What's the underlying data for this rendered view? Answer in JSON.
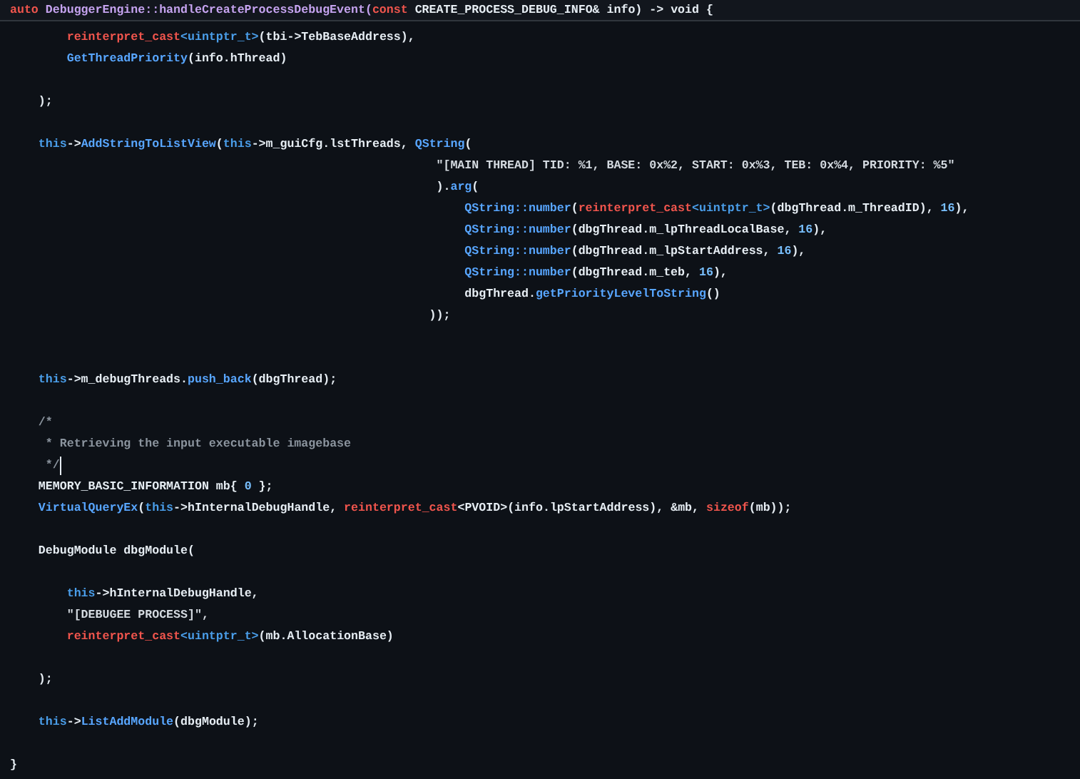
{
  "sticky_header": {
    "tokens": [
      {
        "kind": "cast",
        "text": "auto"
      },
      {
        "kind": "name",
        "text": " DebuggerEngine::handleCreateProcessDebugEvent("
      },
      {
        "kind": "cast",
        "text": "const"
      },
      {
        "kind": "plain",
        "text": " CREATE_PROCESS_DEBUG_INFO& info) -> void {"
      }
    ]
  },
  "lines": [
    {
      "cursor": false,
      "tokens": [
        {
          "kind": "cast",
          "text": "        reinterpret_cast"
        },
        {
          "kind": "keyword",
          "text": "<uintptr_t>"
        },
        {
          "kind": "plain",
          "text": "(tbi->TebBaseAddress),"
        }
      ]
    },
    {
      "cursor": false,
      "tokens": [
        {
          "kind": "function",
          "text": "        GetThreadPriority"
        },
        {
          "kind": "plain",
          "text": "(info.hThread)"
        }
      ]
    },
    {
      "cursor": false
    },
    {
      "cursor": false,
      "tokens": [
        {
          "kind": "plain",
          "text": "    );"
        }
      ]
    },
    {
      "cursor": false
    },
    {
      "cursor": false,
      "tokens": [
        {
          "kind": "keyword",
          "text": "    this"
        },
        {
          "kind": "plain",
          "text": "->"
        },
        {
          "kind": "function",
          "text": "AddStringToListView"
        },
        {
          "kind": "plain",
          "text": "("
        },
        {
          "kind": "keyword",
          "text": "this"
        },
        {
          "kind": "plain",
          "text": "->m_guiCfg.lstThreads, "
        },
        {
          "kind": "function",
          "text": "QString"
        },
        {
          "kind": "plain",
          "text": "("
        }
      ]
    },
    {
      "cursor": false,
      "tokens": [
        {
          "kind": "string",
          "text": "                                                            \"[MAIN THREAD] TID: %1, BASE: 0x%2, START: 0x%3, TEB: 0x%4, PRIORITY: %5\""
        }
      ]
    },
    {
      "cursor": false,
      "tokens": [
        {
          "kind": "plain",
          "text": "                                                            )."
        },
        {
          "kind": "function",
          "text": "arg"
        },
        {
          "kind": "plain",
          "text": "("
        }
      ]
    },
    {
      "cursor": false,
      "tokens": [
        {
          "kind": "function",
          "text": "                                                                QString::number"
        },
        {
          "kind": "plain",
          "text": "("
        },
        {
          "kind": "cast",
          "text": "reinterpret_cast"
        },
        {
          "kind": "keyword",
          "text": "<uintptr_t>"
        },
        {
          "kind": "plain",
          "text": "(dbgThread.m_ThreadID), "
        },
        {
          "kind": "number",
          "text": "16"
        },
        {
          "kind": "plain",
          "text": "),"
        }
      ]
    },
    {
      "cursor": false,
      "tokens": [
        {
          "kind": "function",
          "text": "                                                                QString::number"
        },
        {
          "kind": "plain",
          "text": "(dbgThread.m_lpThreadLocalBase, "
        },
        {
          "kind": "number",
          "text": "16"
        },
        {
          "kind": "plain",
          "text": "),"
        }
      ]
    },
    {
      "cursor": false,
      "tokens": [
        {
          "kind": "function",
          "text": "                                                                QString::number"
        },
        {
          "kind": "plain",
          "text": "(dbgThread.m_lpStartAddress, "
        },
        {
          "kind": "number",
          "text": "16"
        },
        {
          "kind": "plain",
          "text": "),"
        }
      ]
    },
    {
      "cursor": false,
      "tokens": [
        {
          "kind": "function",
          "text": "                                                                QString::number"
        },
        {
          "kind": "plain",
          "text": "(dbgThread.m_teb, "
        },
        {
          "kind": "number",
          "text": "16"
        },
        {
          "kind": "plain",
          "text": "),"
        }
      ]
    },
    {
      "cursor": false,
      "tokens": [
        {
          "kind": "plain",
          "text": "                                                                dbgThread."
        },
        {
          "kind": "function",
          "text": "getPriorityLevelToString"
        },
        {
          "kind": "plain",
          "text": "()"
        }
      ]
    },
    {
      "cursor": false,
      "tokens": [
        {
          "kind": "plain",
          "text": "                                                           ));"
        }
      ]
    },
    {
      "cursor": false
    },
    {
      "cursor": false
    },
    {
      "cursor": false,
      "tokens": [
        {
          "kind": "keyword",
          "text": "    this"
        },
        {
          "kind": "plain",
          "text": "->m_debugThreads."
        },
        {
          "kind": "function",
          "text": "push_back"
        },
        {
          "kind": "plain",
          "text": "(dbgThread);"
        }
      ]
    },
    {
      "cursor": false
    },
    {
      "cursor": false,
      "tokens": [
        {
          "kind": "comment",
          "text": "    /*"
        }
      ]
    },
    {
      "cursor": false,
      "tokens": [
        {
          "kind": "comment",
          "text": "     * Retrieving the input executable imagebase"
        }
      ]
    },
    {
      "cursor": true,
      "tokens": [
        {
          "kind": "comment",
          "text": "     */"
        }
      ]
    },
    {
      "cursor": false,
      "tokens": [
        {
          "kind": "plain",
          "text": "    MEMORY_BASIC_INFORMATION mb{ "
        },
        {
          "kind": "number",
          "text": "0"
        },
        {
          "kind": "plain",
          "text": " };"
        }
      ]
    },
    {
      "cursor": false,
      "tokens": [
        {
          "kind": "function",
          "text": "    VirtualQueryEx"
        },
        {
          "kind": "plain",
          "text": "("
        },
        {
          "kind": "keyword",
          "text": "this"
        },
        {
          "kind": "plain",
          "text": "->hInternalDebugHandle, "
        },
        {
          "kind": "cast",
          "text": "reinterpret_cast"
        },
        {
          "kind": "plain",
          "text": "<PVOID>(info.lpStartAddress), &mb, "
        },
        {
          "kind": "cast",
          "text": "sizeof"
        },
        {
          "kind": "plain",
          "text": "(mb));"
        }
      ]
    },
    {
      "cursor": false
    },
    {
      "cursor": false,
      "tokens": [
        {
          "kind": "plain",
          "text": "    DebugModule dbgModule("
        }
      ]
    },
    {
      "cursor": false
    },
    {
      "cursor": false,
      "tokens": [
        {
          "kind": "keyword",
          "text": "        this"
        },
        {
          "kind": "plain",
          "text": "->hInternalDebugHandle,"
        }
      ]
    },
    {
      "cursor": false,
      "tokens": [
        {
          "kind": "string",
          "text": "        \"[DEBUGEE PROCESS]\","
        }
      ]
    },
    {
      "cursor": false,
      "tokens": [
        {
          "kind": "cast",
          "text": "        reinterpret_cast"
        },
        {
          "kind": "keyword",
          "text": "<uintptr_t>"
        },
        {
          "kind": "plain",
          "text": "(mb.AllocationBase)"
        }
      ]
    },
    {
      "cursor": false
    },
    {
      "cursor": false,
      "tokens": [
        {
          "kind": "plain",
          "text": "    );"
        }
      ]
    },
    {
      "cursor": false
    },
    {
      "cursor": false,
      "tokens": [
        {
          "kind": "keyword",
          "text": "    this"
        },
        {
          "kind": "plain",
          "text": "->"
        },
        {
          "kind": "function",
          "text": "ListAddModule"
        },
        {
          "kind": "plain",
          "text": "(dbgModule);"
        }
      ]
    },
    {
      "cursor": false
    },
    {
      "cursor": false,
      "tokens": [
        {
          "kind": "plain",
          "text": "}"
        }
      ]
    }
  ]
}
